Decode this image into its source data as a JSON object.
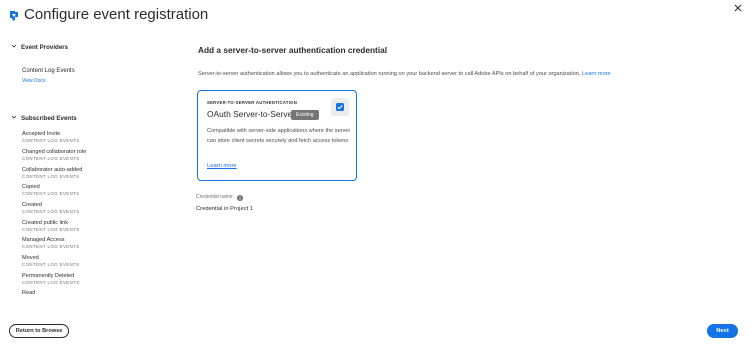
{
  "header": {
    "title": "Configure event registration"
  },
  "sidebar": {
    "providers_heading": "Event Providers",
    "provider": {
      "name": "Content Log Events",
      "docs_link": "View Docs"
    },
    "subscribed_heading": "Subscribed Events",
    "events": [
      {
        "name": "Accepted Invite",
        "source": "CONTENT LOG EVENTS"
      },
      {
        "name": "Changed collaborator role",
        "source": "CONTENT LOG EVENTS"
      },
      {
        "name": "Collaborator auto-added",
        "source": "CONTENT LOG EVENTS"
      },
      {
        "name": "Copied",
        "source": "CONTENT LOG EVENTS"
      },
      {
        "name": "Created",
        "source": "CONTENT LOG EVENTS"
      },
      {
        "name": "Created public link",
        "source": "CONTENT LOG EVENTS"
      },
      {
        "name": "Managed Access",
        "source": "CONTENT LOG EVENTS"
      },
      {
        "name": "Moved",
        "source": "CONTENT LOG EVENTS"
      },
      {
        "name": "Permanently Deleted",
        "source": "CONTENT LOG EVENTS"
      },
      {
        "name": "Read",
        "source": ""
      }
    ]
  },
  "main": {
    "heading": "Add a server-to-server authentication credential",
    "description": "Server-to-server authentication allows you to authenticate an application running on your backend server to call Adobe APIs on behalf of your organization.",
    "learn_more": "Learn more",
    "card": {
      "overline": "SERVER-TO-SERVER AUTHENTICATION",
      "title": "OAuth Server-to-Server",
      "badge": "Existing",
      "checked": true,
      "body": "Compatible with server-side applications where the server can store client secrets securely and fetch access tokens",
      "link": "Learn more"
    },
    "credential": {
      "label": "Credential name",
      "value": "Credential in Project 1"
    }
  },
  "footer": {
    "return_button": "Return to Browse",
    "next_button": "Next"
  },
  "colors": {
    "accent": "#1473e6",
    "badge": "#757575",
    "text": "#2c2c2c"
  },
  "icons": [
    "app-logo-icon",
    "close-icon",
    "chevron-down-icon",
    "checkmark-icon",
    "info-icon"
  ]
}
